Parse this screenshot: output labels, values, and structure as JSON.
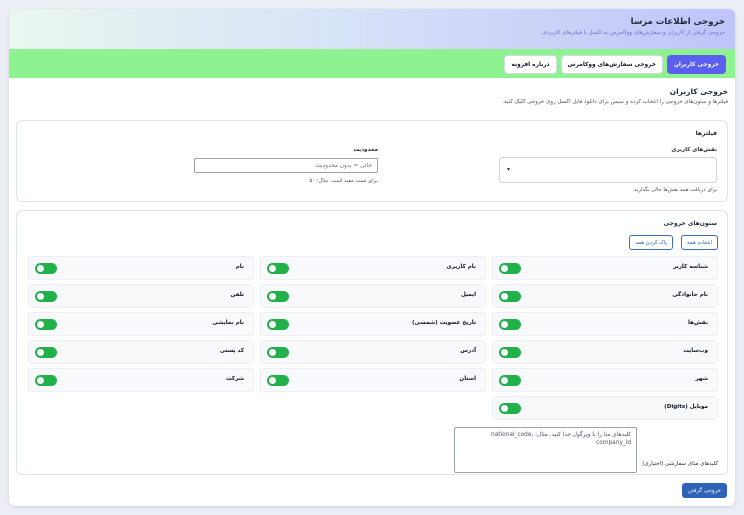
{
  "header": {
    "title": "خروجی اطلاعات مرسا",
    "subtitle": "خروجی گرفتن از کاربران و سفارش‌های ووکامرس به اکسل با فیلترهای کاربردی."
  },
  "tabs": [
    {
      "label": "خروجی کاربران",
      "active": true
    },
    {
      "label": "خروجی سفارش‌های ووکامرس",
      "active": false
    },
    {
      "label": "درباره افزونه",
      "active": false
    }
  ],
  "section": {
    "title": "خروجی کاربران",
    "description": "فیلترها و ستون‌های خروجی را انتخاب کرده و سپس برای دانلود فایل اکسل روی خروجی کلیک کنید."
  },
  "filters": {
    "title": "فیلترها",
    "roles_label": "نقش‌های کاربری",
    "roles_selected": "",
    "roles_hint": "برای دریافت همه نقش‌ها خالی بگذارید.",
    "limit_label": "محدودیت",
    "limit_placeholder": "خالی = بدون محدودیت",
    "limit_value": "",
    "limit_hint": "برای تست مفید است. مثال: ۵۰"
  },
  "columns": {
    "title": "ستون‌های خروجی",
    "select_all": "انتخاب همه",
    "clear_all": "پاک کردن همه",
    "rows": [
      [
        {
          "label": "شناسه کاربر",
          "on": true
        },
        {
          "label": "نام کاربری",
          "on": true
        },
        {
          "label": "نام",
          "on": true
        }
      ],
      [
        {
          "label": "نام خانوادگی",
          "on": true
        },
        {
          "label": "ایمیل",
          "on": true
        },
        {
          "label": "تلفن",
          "on": true
        }
      ],
      [
        {
          "label": "نقش‌ها",
          "on": true
        },
        {
          "label": "تاریخ عضویت (شمسی)",
          "on": true
        },
        {
          "label": "نام نمایشی",
          "on": true
        }
      ],
      [
        {
          "label": "وب‌سایت",
          "on": true
        },
        {
          "label": "آدرس",
          "on": true
        },
        {
          "label": "کد پستی",
          "on": true
        }
      ],
      [
        {
          "label": "شهر",
          "on": true
        },
        {
          "label": "استان",
          "on": true
        },
        {
          "label": "شرکت",
          "on": true
        }
      ],
      [
        {
          "label": "موبایل (Digits)",
          "on": true
        }
      ]
    ],
    "meta_label": "کلیدهای متای سفارشی (اختیاری)",
    "meta_placeholder": "کلیدهای متا را با ویرگول جدا کنید. مثال: national_code, company_id",
    "meta_value": ""
  },
  "actions": {
    "export_label": "خروجی گرفتن"
  },
  "colors": {
    "accent": "#5a5ff0",
    "tabbar": "#8ef290",
    "toggle_on": "#22b04a",
    "primary_button": "#2f63b8"
  }
}
